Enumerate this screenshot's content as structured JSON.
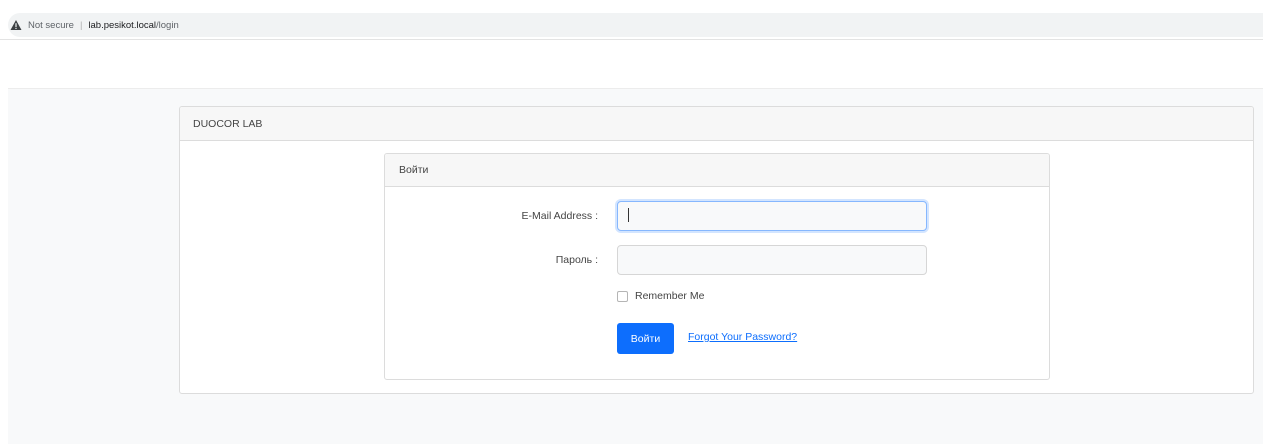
{
  "browser": {
    "security_label": "Not secure",
    "separator": "|",
    "url_host": "lab.pesikot.local",
    "url_path": "/login"
  },
  "app": {
    "title": "DUOCOR LAB"
  },
  "login_card": {
    "title": "Войти",
    "email_label": "E-Mail Address :",
    "email_value": "",
    "password_label": "Пароль :",
    "password_value": "",
    "remember_label": "Remember Me",
    "remember_checked": false,
    "submit_label": "Войти",
    "forgot_label": "Forgot Your Password?"
  },
  "colors": {
    "primary": "#0d6efd",
    "focus_border": "#86b7fe"
  }
}
